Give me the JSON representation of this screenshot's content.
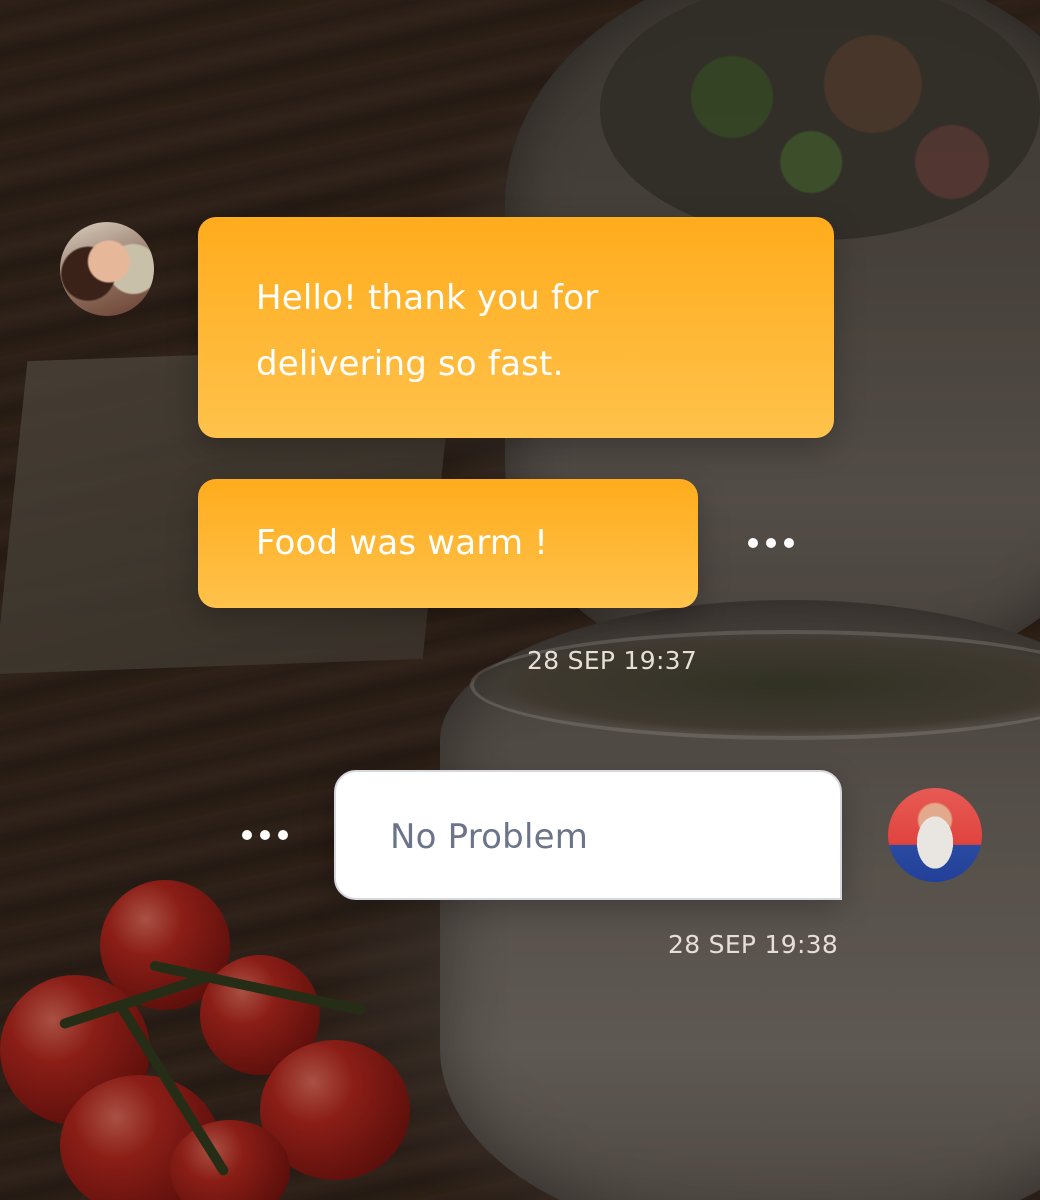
{
  "conversation": {
    "messages": [
      {
        "sender": "customer",
        "lines": [
          "Hello! thank you for",
          "delivering so fast."
        ]
      },
      {
        "sender": "customer",
        "text": "Food was warm !"
      },
      {
        "sender": "courier",
        "text": "No Problem"
      }
    ],
    "timestamps": [
      "28 SEP 19:37",
      "28 SEP 19:38"
    ]
  },
  "icons": {
    "more_options": "more-dots-icon"
  },
  "colors": {
    "outgoing_bubble_top": "#ffac1d",
    "outgoing_bubble_bottom": "#ffc24b",
    "incoming_bubble": "#ffffff",
    "incoming_text": "#6b7489",
    "timestamp_text": "#e6dfd7"
  }
}
